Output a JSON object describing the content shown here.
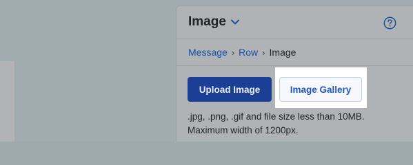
{
  "panel": {
    "title": "Image",
    "title_icon": "chevron-down-icon",
    "help_icon": "question-circle-icon",
    "breadcrumb": {
      "items": [
        "Message",
        "Row",
        "Image"
      ],
      "separator": "›"
    },
    "buttons": {
      "upload_label": "Upload Image",
      "gallery_label": "Image Gallery"
    },
    "help_text": {
      "line1": ".jpg, .png, .gif and file size less than 10MB.",
      "line2": "Maximum width of 1200px."
    }
  },
  "colors": {
    "accent": "#1a3f94",
    "link": "#1e4fa0",
    "gallery_text": "#2456b8",
    "overlay_bg": "#a1acb0",
    "highlight": "#ffffff"
  }
}
